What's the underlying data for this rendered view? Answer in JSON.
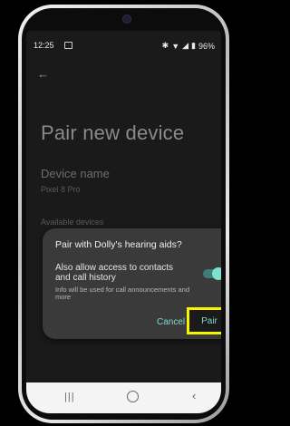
{
  "status_bar": {
    "time": "12:25",
    "battery": "96%",
    "icons": [
      "bluetooth-icon",
      "wifi-icon",
      "signal-icon",
      "battery-icon"
    ]
  },
  "page": {
    "title": "Pair new device",
    "device_name_label": "Device name",
    "device_name_value": "Pixel 8 Pro",
    "available_devices_label": "Available devices"
  },
  "dialog": {
    "title": "Pair with Dolly's hearing aids?",
    "option_label": "Also allow access to contacts and call history",
    "option_hint": "Info will be used for call announcements and more",
    "toggle_on": true,
    "cancel_label": "Cancel",
    "pair_label": "Pair"
  },
  "colors": {
    "accent": "#80d8c8",
    "highlight": "#f5f500",
    "dialog_bg": "#3a3a3a",
    "screen_bg": "#1b1a1a"
  }
}
